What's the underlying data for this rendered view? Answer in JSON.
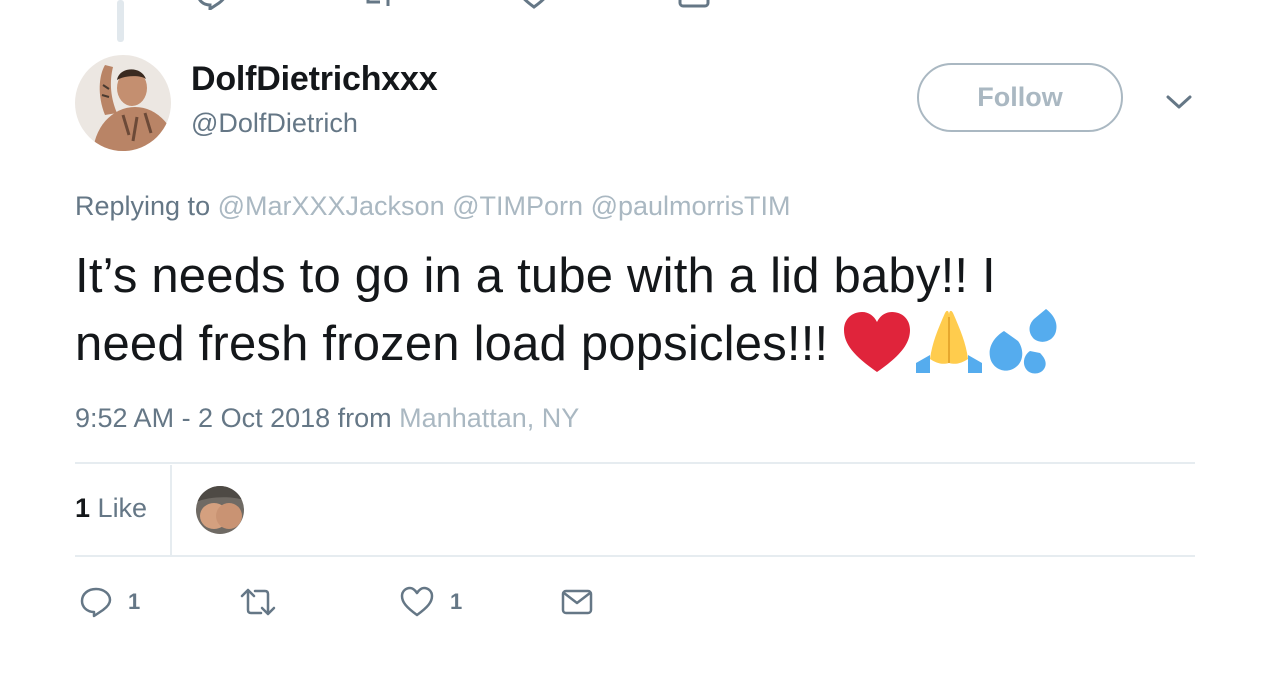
{
  "user": {
    "display_name": "DolfDietrichxxx",
    "handle": "@DolfDietrich"
  },
  "follow_label": "Follow",
  "replying": {
    "prefix": "Replying to",
    "mentions": [
      "@MarXXXJackson",
      "@TIMPorn",
      "@paulmorrisTIM"
    ]
  },
  "tweet": {
    "line1": "It’s needs to go in a tube with a lid baby!! I",
    "line2": "need fresh frozen load popsicles!!! ",
    "emojis": [
      "red-heart",
      "folded-hands",
      "sweat-droplets"
    ]
  },
  "meta": {
    "time": "9:52 AM - 2 Oct 2018 from",
    "place": "Manhattan, NY"
  },
  "likes": {
    "count": "1",
    "label": "Like"
  },
  "actions": {
    "reply_count": "1",
    "retweet_count": "",
    "like_count": "1"
  },
  "colors": {
    "text_primary": "#14171a",
    "text_secondary": "#657786",
    "muted": "#aab8c2",
    "border": "#e6ecf0",
    "heart_red": "#e0243b",
    "hands_yellow": "#ffcc4d",
    "sleeve_blue": "#55acee"
  }
}
